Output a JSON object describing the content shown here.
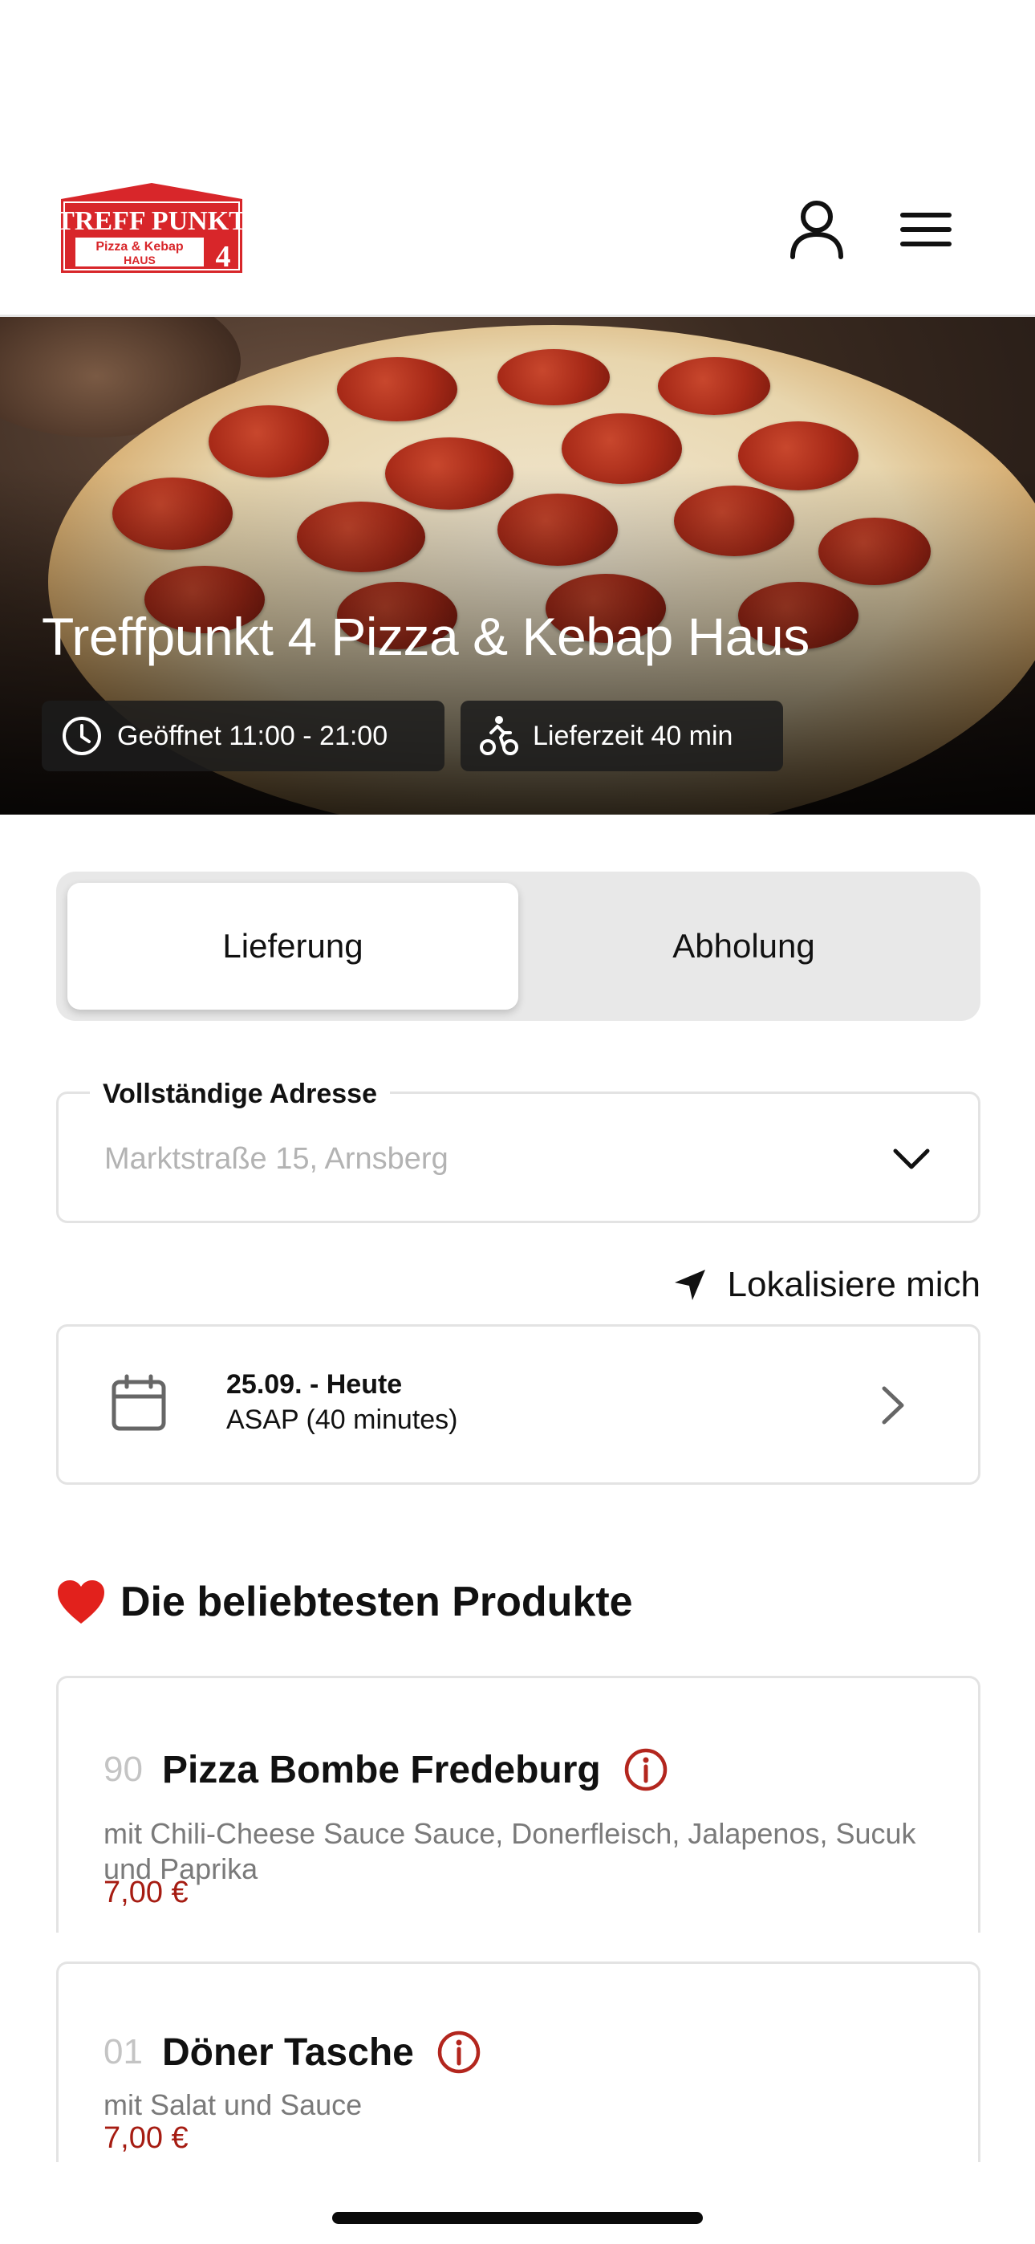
{
  "header": {
    "logo": {
      "line1": "TREFF PUNKT",
      "line2": "Pizza & Kebap",
      "line3": "HAUS",
      "number": "4"
    },
    "account_icon": "user-icon",
    "menu_icon": "hamburger-menu-icon"
  },
  "hero": {
    "title": "Treffpunkt 4 Pizza & Kebap Haus",
    "opening": "Geöffnet 11:00 - 21:00",
    "delivery_time": "Lieferzeit 40 min"
  },
  "order_mode": {
    "options": [
      "Lieferung",
      "Abholung"
    ],
    "selected": "Lieferung"
  },
  "address": {
    "label": "Vollständige Adresse",
    "placeholder": "Marktstraße 15, Arnsberg",
    "value": ""
  },
  "locate": {
    "label": "Lokalisiere mich"
  },
  "schedule": {
    "date": "25.09. - Heute",
    "time": "ASAP (40 minutes)"
  },
  "popular": {
    "title": "Die beliebtesten Produkte",
    "products": [
      {
        "number": "90",
        "name": "Pizza Bombe Fredeburg",
        "description": "mit Chili-Cheese Sauce Sauce, Donerfleisch, Jalapenos, Sucuk und Paprika",
        "price": "7,00 €"
      },
      {
        "number": "01",
        "name": "Döner Tasche",
        "description": "mit Salat und Sauce",
        "price": "7,00 €"
      }
    ]
  },
  "colors": {
    "brand_red": "#d8262a",
    "price_red": "#a61c12",
    "info_red": "#b3261e"
  }
}
